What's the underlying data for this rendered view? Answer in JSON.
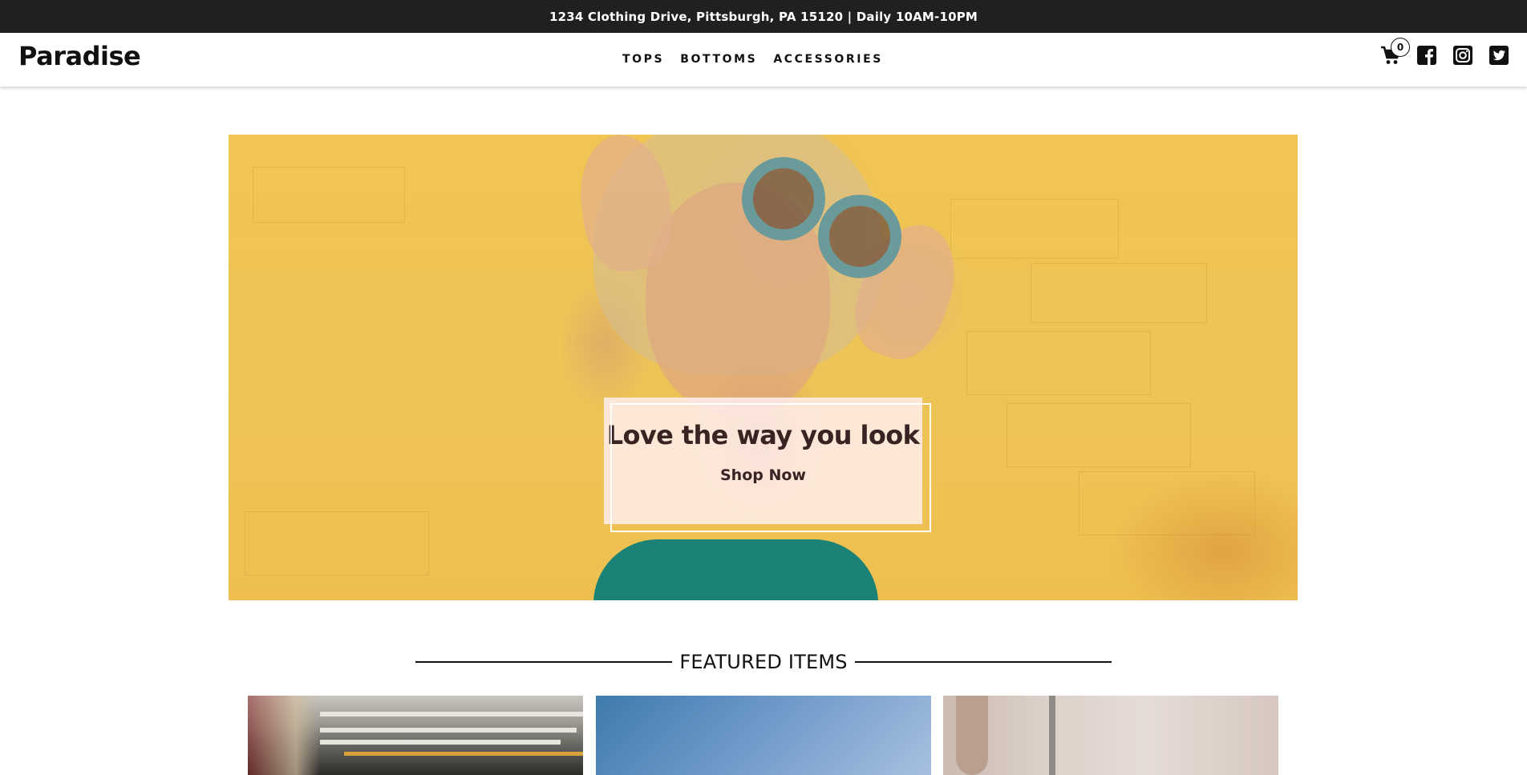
{
  "topbar": {
    "text": "1234 Clothing Drive, Pittsburgh, PA 15120 | Daily 10AM-10PM"
  },
  "header": {
    "brand": "Paradise",
    "nav": [
      {
        "label": "TOPS"
      },
      {
        "label": "BOTTOMS"
      },
      {
        "label": "ACCESSORIES"
      }
    ],
    "cart_count": "0",
    "icons": [
      "shopping-cart-icon",
      "facebook-icon",
      "instagram-icon",
      "twitter-icon"
    ]
  },
  "hero": {
    "title": "Love the way you look",
    "cta": "Shop Now"
  },
  "featured": {
    "title": "FEATURED ITEMS"
  },
  "colors": {
    "topbar_bg": "#202020",
    "hero_card_bg": "#ffeeee",
    "hero_text": "#3a2323"
  }
}
